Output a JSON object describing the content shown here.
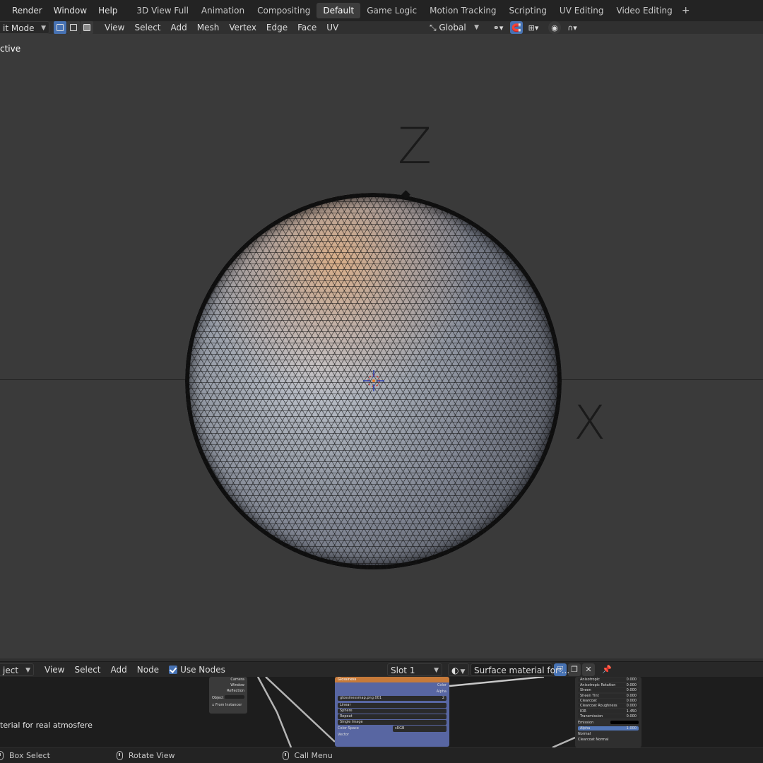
{
  "topbar": {
    "menus": [
      "Render",
      "Window",
      "Help"
    ],
    "workspace_tabs": [
      {
        "label": "3D View Full",
        "active": false
      },
      {
        "label": "Animation",
        "active": false
      },
      {
        "label": "Compositing",
        "active": false
      },
      {
        "label": "Default",
        "active": true
      },
      {
        "label": "Game Logic",
        "active": false
      },
      {
        "label": "Motion Tracking",
        "active": false
      },
      {
        "label": "Scripting",
        "active": false
      },
      {
        "label": "UV Editing",
        "active": false
      },
      {
        "label": "Video Editing",
        "active": false
      }
    ],
    "add_tab_label": "+"
  },
  "viewport_header": {
    "mode": "it Mode",
    "menus": [
      "View",
      "Select",
      "Add",
      "Mesh",
      "Vertex",
      "Edge",
      "Face",
      "UV"
    ],
    "transform_orientation": "Global"
  },
  "viewport": {
    "mode_label": "ctive",
    "axis_z": "Z",
    "axis_x": "X"
  },
  "node_header": {
    "editor_type": "ject",
    "menus": [
      "View",
      "Select",
      "Add",
      "Node"
    ],
    "use_nodes_label": "Use Nodes",
    "use_nodes_checked": true,
    "slot": "Slot 1",
    "material_name": "Surface material for ..."
  },
  "node_editor": {
    "frame_label": "terial for real atmosfere",
    "texcoord_outputs": [
      "Camera",
      "Window",
      "Reflection"
    ],
    "texcoord_object_label": "Object",
    "texcoord_from_instancer": "From Instancer",
    "image_node": {
      "title": "Glossiness",
      "outputs": [
        "Color",
        "Alpha"
      ],
      "image_name": "glossinessmap.png.001",
      "user_count": "2",
      "interpolation": "Linear",
      "projection": "Sphere",
      "extension": "Repeat",
      "source": "Single Image",
      "color_space_label": "Color Space",
      "color_space": "sRGB",
      "vector_label": "Vector"
    },
    "bsdf_rows": [
      {
        "label": "Anisotropic",
        "value": "0.000"
      },
      {
        "label": "Anisotropic Rotation",
        "value": "0.000"
      },
      {
        "label": "Sheen",
        "value": "0.000"
      },
      {
        "label": "Sheen Tint",
        "value": "0.000"
      },
      {
        "label": "Clearcoat",
        "value": "0.000"
      },
      {
        "label": "Clearcoat Roughness",
        "value": "0.000"
      },
      {
        "label": "IOR",
        "value": "1.450"
      },
      {
        "label": "Transmission",
        "value": "0.000"
      }
    ],
    "bsdf_emission": "Emission",
    "bsdf_alpha": {
      "label": "Alpha",
      "value": "1.000"
    },
    "bsdf_normal": "Normal",
    "bsdf_clearcoat_normal": "Clearcoat Normal"
  },
  "statusbar": {
    "items": [
      "Box Select",
      "Rotate View",
      "Call Menu"
    ]
  },
  "colors": {
    "accent": "#4772b3",
    "active_tab": "#3d3d3d",
    "header_bg": "#232323",
    "viewport_bg": "#3a3a3a"
  }
}
